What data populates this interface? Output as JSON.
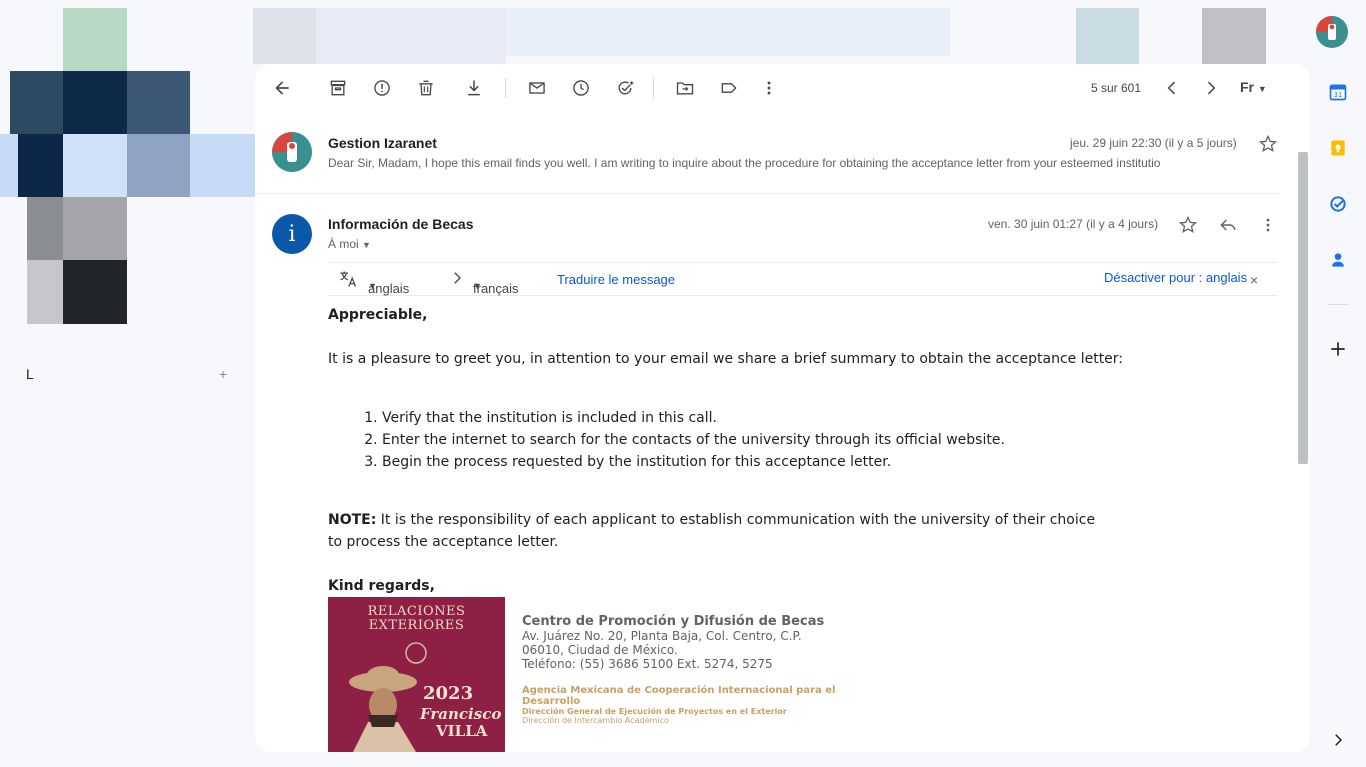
{
  "left": {
    "letter": "L"
  },
  "toolbar": {
    "pager": "5 sur 601",
    "lang": "Fr"
  },
  "thread": [
    {
      "sender": "Gestion Izaranet",
      "date": "jeu. 29 juin 22:30 (il y a 5 jours)",
      "snippet": "Dear Sir, Madam, I hope this email finds you well. I am writing to inquire about the procedure for obtaining the acceptance letter from your esteemed institutio"
    },
    {
      "sender": "Información de Becas",
      "avatar_letter": "i",
      "date": "ven. 30 juin 01:27 (il y a 4 jours)",
      "to": "À moi"
    }
  ],
  "translation": {
    "source": "anglais",
    "target": "français",
    "translate": "Traduire le message",
    "deactivate": "Désactiver pour : anglais"
  },
  "body": {
    "greeting": "Appreciable,",
    "intro": "It is a pleasure to greet you, in attention to your email we share a brief summary to obtain the acceptance letter:",
    "steps": [
      "Verify that the institution is included in this call.",
      "Enter the internet to search for the contacts of the university through its official website.",
      "Begin the process requested by the institution for this acceptance letter."
    ],
    "note_label": "NOTE:",
    "note_line1": " It is the responsibility of each applicant to establish communication with the university of their choice",
    "note_line2": "to process the acceptance letter.",
    "closing": "Kind regards,"
  },
  "signature": {
    "image": {
      "line1": "RELACIONES",
      "line2": "EXTERIORES",
      "year": "2023",
      "name1": "Francisco",
      "name2": "VILLA"
    },
    "org": "Centro de Promoción y Difusión de Becas",
    "addr1": "Av. Juárez No. 20, Planta Baja, Col. Centro, C.P.",
    "addr2": "06010, Ciudad de México.",
    "phone": "Teléfono: (55) 3686 5100 Ext. 5274, 5275",
    "agency": "Agencia Mexicana de Cooperación Internacional para el",
    "agency2": "Desarrollo",
    "dept1": "Dirección General de Ejecución de Proyectos en el Exterior",
    "dept2": "Dirección de Intercambio Académico"
  },
  "colors": {
    "accent": "#0b57d0",
    "brand_wine": "#8e1f45",
    "sig_gold": "#c9a063"
  }
}
